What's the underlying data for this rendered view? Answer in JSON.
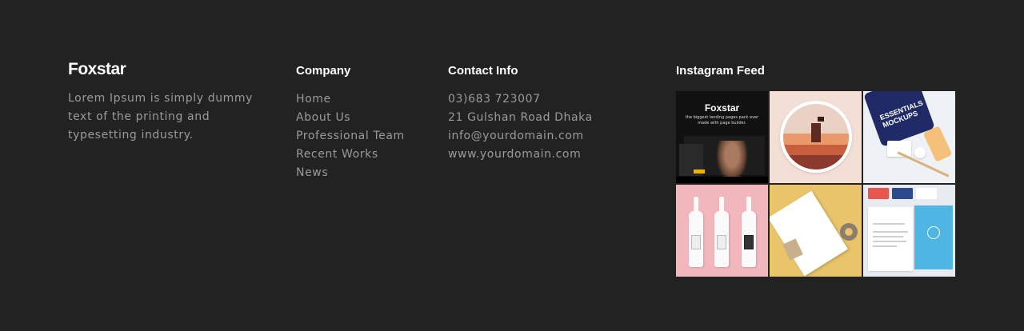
{
  "brand": {
    "logo": "Foxstar",
    "description": "Lorem Ipsum is simply dummy text of the printing and typesetting industry."
  },
  "company": {
    "heading": "Company",
    "links": [
      "Home",
      "About Us",
      "Professional Team",
      "Recent Works",
      "News"
    ]
  },
  "contact": {
    "heading": "Contact Info",
    "items": [
      "03)683 723007",
      "21 Gulshan Road Dhaka",
      "info@yourdomain.com",
      "www.yourdomain.com"
    ]
  },
  "instagram": {
    "heading": "Instagram Feed",
    "tile1_title": "Foxstar",
    "tile1_subtitle": "the biggest landing pages pack ever made with page builder.",
    "tile3_text": "ESSENTIALS MOCKUPS"
  },
  "colors": {
    "background": "#222222",
    "heading": "#ffffff",
    "text": "#9a9a9a"
  }
}
